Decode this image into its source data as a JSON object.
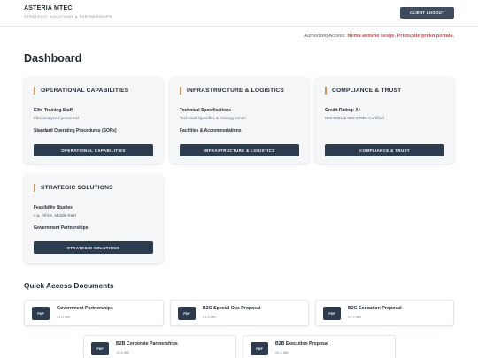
{
  "header": {
    "brand_name": "ASTERIA MTEC",
    "brand_tagline": "STRATEGIC SOLUTIONS & PARTNERSHIPS",
    "logout_label": "CLIENT LOGOUT"
  },
  "auth": {
    "prefix": "Authorized Access:",
    "status": "Nema aktivne sesije. Pristupite preko portala."
  },
  "page_title": "Dashboard",
  "cards": [
    {
      "title": "OPERATIONAL CAPABILITIES",
      "item1_title": "Elite Training Staff",
      "item1_desc": "Elite analyzed personnel",
      "item2_title": "Standard Operating Procedures (SOPs)",
      "button": "OPERATIONAL CAPABILITIES"
    },
    {
      "title": "INFRASTRUCTURE & LOGISTICS",
      "item1_title": "Technical Specifications",
      "item1_desc": "Technical Specifics & training center",
      "item2_title": "Facilities & Accommodations",
      "button": "INFRASTRUCTURE & LOGISTICS"
    },
    {
      "title": "COMPLIANCE & TRUST",
      "item1_title": "Credit Rating: A+",
      "item1_desc": "ISO 9001 & ISO 27001 Certified",
      "item2_title": "",
      "button": "COMPLIANCE & TRUST"
    },
    {
      "title": "STRATEGIC SOLUTIONS",
      "item1_title": "Feasibility Studies",
      "item1_desc": "e.g. Africa, Middle East",
      "item2_title": "Government Partnerships",
      "button": "STRATEGIC SOLUTIONS"
    }
  ],
  "documents_section_title": "Quick Access Documents",
  "documents": [
    {
      "badge": "PDF",
      "title": "Government Partnerships",
      "size": "21.0 MB"
    },
    {
      "badge": "PDF",
      "title": "B2G Special Ops Proposal",
      "size": "21.3 MB"
    },
    {
      "badge": "PDF",
      "title": "B2G Execution Proposal",
      "size": "27.9 MB"
    },
    {
      "badge": "PDF",
      "title": "B2B Corporate Partnerships",
      "size": "19.5 MB"
    },
    {
      "badge": "PDF",
      "title": "B2B Execution Proposal",
      "size": "24.2 MB"
    }
  ],
  "colors": {
    "accent_bar": "#c7935a",
    "button_dark": "#2d3b4e",
    "status_red": "#d64545",
    "card_bg": "#f4f6f8"
  }
}
